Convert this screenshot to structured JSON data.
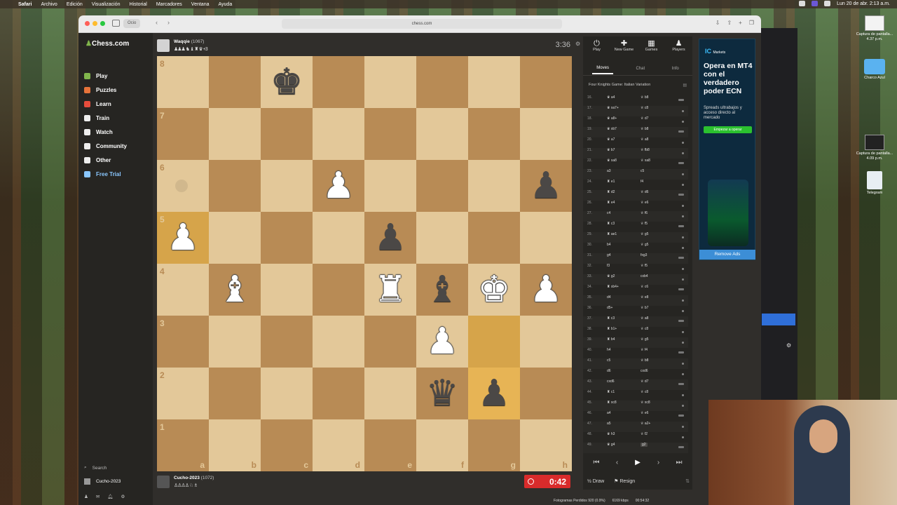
{
  "menubar": {
    "items": [
      "Safari",
      "Archivo",
      "Edición",
      "Visualización",
      "Historial",
      "Marcadores",
      "Ventana",
      "Ayuda"
    ],
    "clock": "Lun 20 de abr.  2:13 a.m."
  },
  "desktop": {
    "icons": [
      {
        "label": "Captura de pantalla... 4.37 p.m."
      },
      {
        "label": "Charco Azul"
      },
      {
        "label": "Captura de pantalla... 4.09 p.m."
      },
      {
        "label": "Telegram"
      }
    ]
  },
  "browser": {
    "tab_group": "Ocio",
    "url": "chess.com"
  },
  "nav": {
    "logo": "Chess.com",
    "items": [
      {
        "label": "Play",
        "color": "#81b64c"
      },
      {
        "label": "Puzzles",
        "color": "#e7733a"
      },
      {
        "label": "Learn",
        "color": "#e74c3c"
      },
      {
        "label": "Train",
        "color": "#f0f0f0"
      },
      {
        "label": "Watch",
        "color": "#f0f0f0"
      },
      {
        "label": "Community",
        "color": "#f0f0f0"
      },
      {
        "label": "Other",
        "color": "#f0f0f0"
      },
      {
        "label": "Free Trial",
        "color": "#8ac7ff"
      }
    ],
    "search": "Search",
    "user": "Cucho-2023"
  },
  "top_player": {
    "name": "Waqqie",
    "rating": "(1067)",
    "captured": "♟♟♟ ♞ ♝ ♜ ♛ +3",
    "clock": "3:36"
  },
  "bottom_player": {
    "name": "Cucho-2023",
    "rating": "(1072)",
    "captured": "♙♙♙♙ ♘ ♗",
    "clock": "0:42"
  },
  "board": {
    "ranks": [
      "8",
      "7",
      "6",
      "5",
      "4",
      "3",
      "2",
      "1"
    ],
    "files": [
      "a",
      "b",
      "c",
      "d",
      "e",
      "f",
      "g",
      "h"
    ],
    "highlighted": [
      "g3",
      "g2",
      "a5"
    ],
    "pieces": [
      {
        "square": "c8",
        "glyph": "♚",
        "color": "b"
      },
      {
        "square": "d6",
        "glyph": "♟",
        "color": "w"
      },
      {
        "square": "h6",
        "glyph": "♟",
        "color": "b"
      },
      {
        "square": "a5",
        "glyph": "♟",
        "color": "w"
      },
      {
        "square": "e5",
        "glyph": "♟",
        "color": "b"
      },
      {
        "square": "b4",
        "glyph": "♝",
        "color": "w"
      },
      {
        "square": "e4",
        "glyph": "♜",
        "color": "w"
      },
      {
        "square": "f4",
        "glyph": "♝",
        "color": "b"
      },
      {
        "square": "g4",
        "glyph": "♚",
        "color": "w"
      },
      {
        "square": "h4",
        "glyph": "♟",
        "color": "w"
      },
      {
        "square": "f3",
        "glyph": "♟",
        "color": "w"
      },
      {
        "square": "f2",
        "glyph": "♛",
        "color": "b"
      },
      {
        "square": "g2",
        "glyph": "♟",
        "color": "b"
      }
    ]
  },
  "panel": {
    "top_tabs": [
      {
        "icon": "⏻",
        "label": "Play"
      },
      {
        "icon": "✚",
        "label": "New Game"
      },
      {
        "icon": "▦",
        "label": "Games"
      },
      {
        "icon": "♟",
        "label": "Players"
      }
    ],
    "sub_tabs": [
      "Moves",
      "Chat",
      "Info"
    ],
    "opening": "Four Knights Game: Italian Variation",
    "moves": [
      {
        "n": "16.",
        "w": "♛ a4",
        "b": "♕ b8"
      },
      {
        "n": "17.",
        "w": "♛ xa7+",
        "b": "♕ c8"
      },
      {
        "n": "18.",
        "w": "♛ a8+",
        "b": "♕ d7"
      },
      {
        "n": "19.",
        "w": "♛ xb7",
        "b": "♕ b8"
      },
      {
        "n": "20.",
        "w": "♛ a7",
        "b": "♕ a8"
      },
      {
        "n": "21.",
        "w": "♛ b7",
        "b": "♕ fb8"
      },
      {
        "n": "22.",
        "w": "♛ xa8",
        "b": "♕ xa8"
      },
      {
        "n": "23.",
        "w": "a3",
        "b": "c5"
      },
      {
        "n": "24.",
        "w": "♜ e1",
        "b": "f4"
      },
      {
        "n": "25.",
        "w": "♜ d2",
        "b": "♕ d6"
      },
      {
        "n": "26.",
        "w": "♜ e4",
        "b": "♕ e6"
      },
      {
        "n": "27.",
        "w": "c4",
        "b": "♕ f6"
      },
      {
        "n": "28.",
        "w": "♜ c3",
        "b": "♕ f5"
      },
      {
        "n": "29.",
        "w": "♜ ae1",
        "b": "♕ g5"
      },
      {
        "n": "30.",
        "w": "b4",
        "b": "♕ g5"
      },
      {
        "n": "31.",
        "w": "g4",
        "b": "fxg3"
      },
      {
        "n": "32.",
        "w": "f3",
        "b": "♕ f5"
      },
      {
        "n": "33.",
        "w": "♛ g2",
        "b": "cxb4"
      },
      {
        "n": "34.",
        "w": "♜ xb4+",
        "b": "♕ c6"
      },
      {
        "n": "35.",
        "w": "d4",
        "b": "♕ e8"
      },
      {
        "n": "36.",
        "w": "d5+",
        "b": "♕ b7"
      },
      {
        "n": "37.",
        "w": "♜ c3",
        "b": "♕ a8"
      },
      {
        "n": "38.",
        "w": "♜ b1+",
        "b": "♕ c8"
      },
      {
        "n": "39.",
        "w": "♜ b4",
        "b": "♕ g5"
      },
      {
        "n": "40.",
        "w": "h4",
        "b": "♕ f4"
      },
      {
        "n": "41.",
        "w": "c5",
        "b": "♕ b8"
      },
      {
        "n": "42.",
        "w": "d6",
        "b": "cxd6"
      },
      {
        "n": "43.",
        "w": "cxd6",
        "b": "♕ d7"
      },
      {
        "n": "44.",
        "w": "♜ c1",
        "b": "♕ c8"
      },
      {
        "n": "45.",
        "w": "♜ xc8",
        "b": "♕ xc8"
      },
      {
        "n": "46.",
        "w": "a4",
        "b": "♕ e6"
      },
      {
        "n": "47.",
        "w": "a5",
        "b": "♕ a2+"
      },
      {
        "n": "48.",
        "w": "♛ h3",
        "b": "♕ f2"
      },
      {
        "n": "49.",
        "w": "♛ g4",
        "b": "g2"
      }
    ],
    "draw": "Draw",
    "resign": "Resign"
  },
  "ad": {
    "logo": "IC",
    "logo_sub": "Markets",
    "headline": "Opera en MT4 con el verdadero poder ECN",
    "sub": "Spreads ultrabajos y acceso directo al mercado",
    "cta": "Empezar a operar",
    "remove": "Remove Ads"
  },
  "status": {
    "frames": "Fotogramas Perdidos 920 (0.9%)",
    "bitrate": "6169 kbps",
    "time": "00:54:32"
  }
}
